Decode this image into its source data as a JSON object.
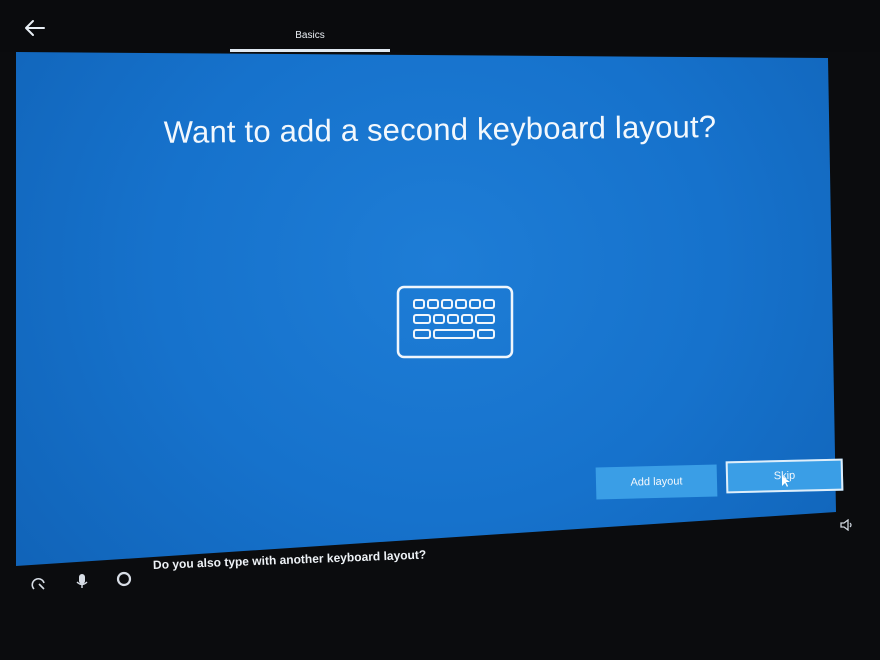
{
  "header": {
    "back_icon": "arrow-left-icon",
    "tab_title": "Basics"
  },
  "main": {
    "headline": "Want to add a second keyboard layout?",
    "hero_icon": "keyboard-icon"
  },
  "actions": {
    "add_layout_label": "Add layout",
    "skip_label": "Skip"
  },
  "taskbar": {
    "icons": [
      "accessibility-icon",
      "microphone-icon",
      "cortana-circle-icon"
    ],
    "prompt": "Do you also type with another keyboard layout?",
    "volume_icon": "volume-icon"
  },
  "colors": {
    "screen_blue": "#1672cc",
    "button_blue": "#3a9ee6",
    "text": "#f3f8fd"
  }
}
